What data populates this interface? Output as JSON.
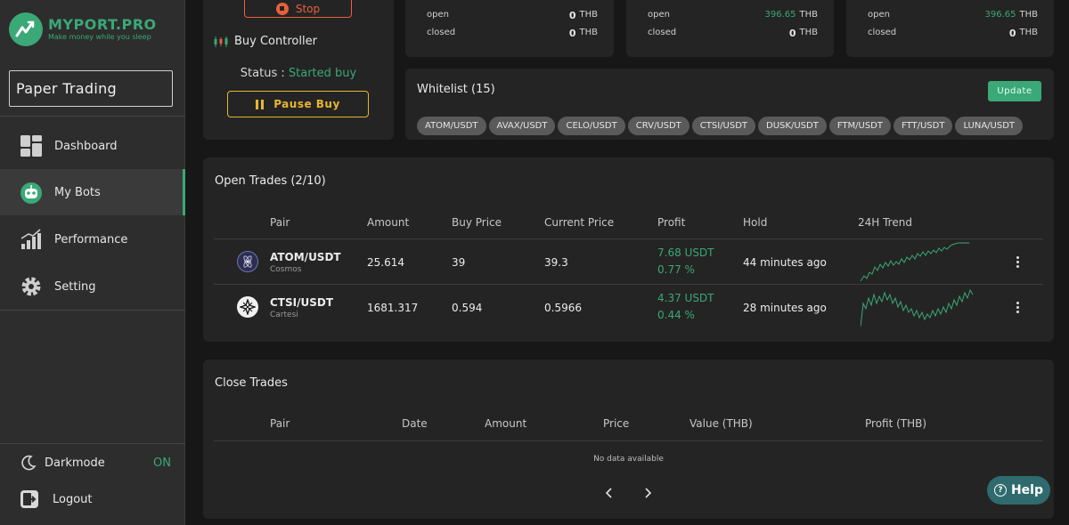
{
  "brand": {
    "name": "MYPORT.PRO",
    "tagline": "Make money while you sleep"
  },
  "sidebar": {
    "mode_label": "Paper Trading",
    "items": [
      {
        "label": "Dashboard",
        "icon": "dashboard-icon"
      },
      {
        "label": "My Bots",
        "icon": "robot-icon",
        "active": true
      },
      {
        "label": "Performance",
        "icon": "bar-chart-icon"
      },
      {
        "label": "Setting",
        "icon": "gear-icon"
      }
    ],
    "darkmode_label": "Darkmode",
    "darkmode_value": "ON",
    "logout_label": "Logout"
  },
  "controller": {
    "stop_label": "Stop",
    "title": "Buy Controller",
    "status_label": "Status :",
    "status_value": "Started buy",
    "pause_label": "Pause Buy"
  },
  "stat_cards": [
    {
      "open_label": "open",
      "open_value": "0",
      "closed_label": "closed",
      "closed_value": "0",
      "unit": "THB"
    },
    {
      "open_label": "open",
      "open_value": "396.65",
      "closed_label": "closed",
      "closed_value": "0",
      "unit": "THB"
    },
    {
      "open_label": "open",
      "open_value": "396.65",
      "closed_label": "closed",
      "closed_value": "0",
      "unit": "THB"
    }
  ],
  "whitelist": {
    "title": "Whitelist (15)",
    "update_label": "Update",
    "pairs": [
      "ATOM/USDT",
      "AVAX/USDT",
      "CELO/USDT",
      "CRV/USDT",
      "CTSI/USDT",
      "DUSK/USDT",
      "FTM/USDT",
      "FTT/USDT",
      "LUNA/USDT"
    ]
  },
  "open_trades": {
    "title": "Open Trades (2/10)",
    "headers": [
      "Pair",
      "Amount",
      "Buy Price",
      "Current Price",
      "Profit",
      "Hold",
      "24H Trend"
    ],
    "rows": [
      {
        "pair": "ATOM/USDT",
        "name": "Cosmos",
        "amount": "25.614",
        "buy_price": "39",
        "current_price": "39.3",
        "profit_usdt": "7.68 USDT",
        "profit_pct": "0.77 %",
        "hold": "44 minutes ago",
        "icon": "cosmos-icon"
      },
      {
        "pair": "CTSI/USDT",
        "name": "Cartesi",
        "amount": "1681.317",
        "buy_price": "0.594",
        "current_price": "0.5966",
        "profit_usdt": "4.37 USDT",
        "profit_pct": "0.44 %",
        "hold": "28 minutes ago",
        "icon": "cartesi-icon"
      }
    ]
  },
  "close_trades": {
    "title": "Close Trades",
    "headers": [
      "Pair",
      "Date",
      "Amount",
      "Price",
      "Value (THB)",
      "Profit (THB)"
    ],
    "empty_text": "No data available",
    "prev_icon": "chevron-left-icon",
    "next_icon": "chevron-right-icon"
  },
  "help": {
    "label": "Help"
  },
  "colors": {
    "accent": "#3aa877",
    "stop": "#e8603c",
    "pause": "#e6b630",
    "help": "#2f6b6e"
  }
}
